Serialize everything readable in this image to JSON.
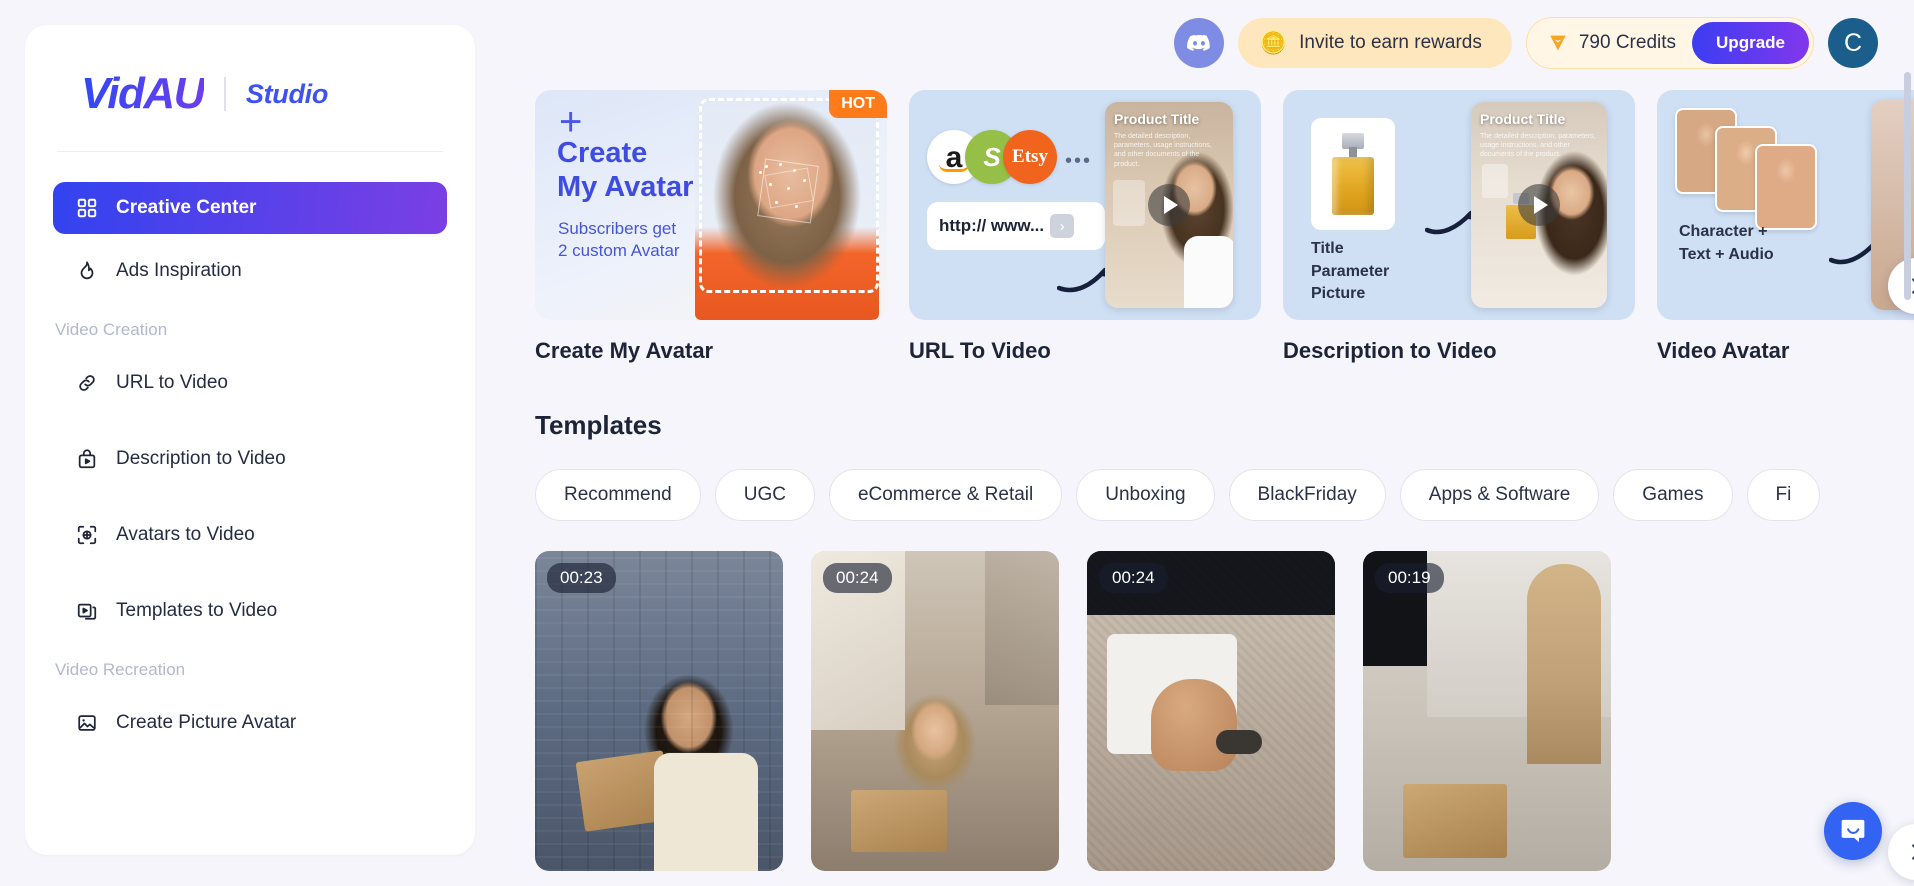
{
  "brand": {
    "name": "VidAU",
    "product": "Studio"
  },
  "sidebar": {
    "primary": [
      {
        "label": "Creative Center",
        "icon": "grid-icon",
        "active": true
      },
      {
        "label": "Ads Inspiration",
        "icon": "flame-icon",
        "active": false
      }
    ],
    "groups": [
      {
        "label": "Video Creation",
        "items": [
          {
            "label": "URL to Video",
            "icon": "link-icon"
          },
          {
            "label": "Description to Video",
            "icon": "bag-play-icon"
          },
          {
            "label": "Avatars to Video",
            "icon": "target-icon"
          },
          {
            "label": "Templates to Video",
            "icon": "layers-play-icon"
          }
        ]
      },
      {
        "label": "Video Recreation",
        "items": [
          {
            "label": "Create Picture Avatar",
            "icon": "image-icon"
          }
        ]
      }
    ]
  },
  "topbar": {
    "discord_icon": "discord-icon",
    "invite_label": "Invite to earn rewards",
    "invite_icon": "coins-icon",
    "credits_label": "790 Credits",
    "credits_icon": "diamond-icon",
    "upgrade_label": "Upgrade",
    "avatar_initial": "C"
  },
  "features": {
    "next_label": "›",
    "cards": [
      {
        "title": "Create My Avatar",
        "badge": "HOT",
        "plus": "+",
        "heading_line1": "Create",
        "heading_line2": "My Avatar",
        "sub_line1": "Subscribers get",
        "sub_line2": "2 custom Avatar"
      },
      {
        "title": "URL To Video",
        "url_value": "http:// www...",
        "url_go": "›",
        "merchants": [
          "a",
          "S",
          "Etsy",
          "..."
        ],
        "product_title": "Product Title",
        "product_desc": "The detailed description, parameters, usage instructions, and other documents of the product."
      },
      {
        "title": "Description to Video",
        "line1": "Title",
        "line2": "Parameter",
        "line3": "Picture",
        "product_title": "Product Title",
        "product_desc": "The detailed description, parameters, usage instructions, and other documents of the product."
      },
      {
        "title": "Video Avatar",
        "line1": "Character +",
        "line2": "Text + Audio"
      }
    ]
  },
  "templates": {
    "heading": "Templates",
    "next_label": "›",
    "chips": [
      "Recommend",
      "UGC",
      "eCommerce & Retail",
      "Unboxing",
      "BlackFriday",
      "Apps & Software",
      "Games",
      "Fi"
    ],
    "items": [
      {
        "duration": "00:23"
      },
      {
        "duration": "00:24"
      },
      {
        "duration": "00:24"
      },
      {
        "duration": "00:19"
      }
    ]
  },
  "chat": {
    "icon": "chat-bubble-icon"
  },
  "colors": {
    "accent_blue": "#3243ef",
    "accent_purple": "#7b3fe4",
    "hot_orange": "#ff7a18",
    "credits_bg": "#fff6e6",
    "invite_bg": "#ffe7bd",
    "page_bg": "#f5f5fb"
  }
}
